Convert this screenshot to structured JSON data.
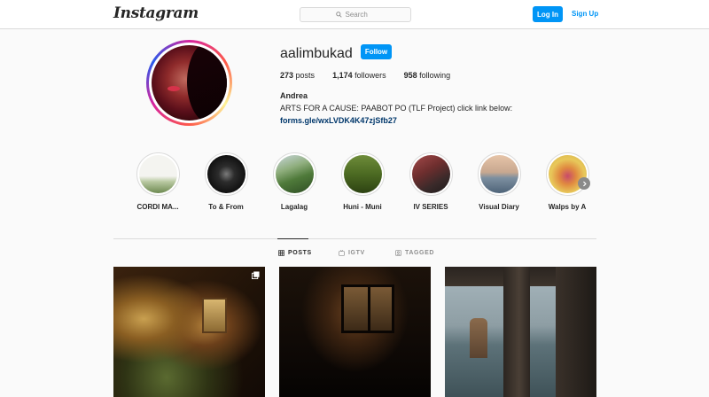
{
  "header": {
    "logo": "Instagram",
    "search_placeholder": "Search",
    "login_label": "Log In",
    "signup_label": "Sign Up"
  },
  "profile": {
    "username": "aalimbukad",
    "follow_label": "Follow",
    "stats": {
      "posts_count": "273",
      "posts_label": "posts",
      "followers_count": "1,174",
      "followers_label": "followers",
      "following_count": "958",
      "following_label": "following"
    },
    "full_name": "Andrea",
    "bio": "ARTS FOR A CAUSE: PAABOT PO (TLF Project) click link below:",
    "link": "forms.gle/wxLVDK4K47zjSfb27"
  },
  "highlights": [
    {
      "label": "CORDI MA..."
    },
    {
      "label": "To & From"
    },
    {
      "label": "Lagalag"
    },
    {
      "label": "Huni - Muni"
    },
    {
      "label": "IV SERIES"
    },
    {
      "label": "Visual Diary"
    },
    {
      "label": "Walps by A"
    }
  ],
  "tabs": [
    {
      "label": "POSTS",
      "icon": "grid-icon",
      "active": true
    },
    {
      "label": "IGTV",
      "icon": "igtv-icon",
      "active": false
    },
    {
      "label": "TAGGED",
      "icon": "tagged-icon",
      "active": false
    }
  ],
  "colors": {
    "accent": "#0095f6",
    "link": "#00376b",
    "text": "#262626",
    "muted": "#8e8e8e",
    "border": "#dbdbdb"
  }
}
